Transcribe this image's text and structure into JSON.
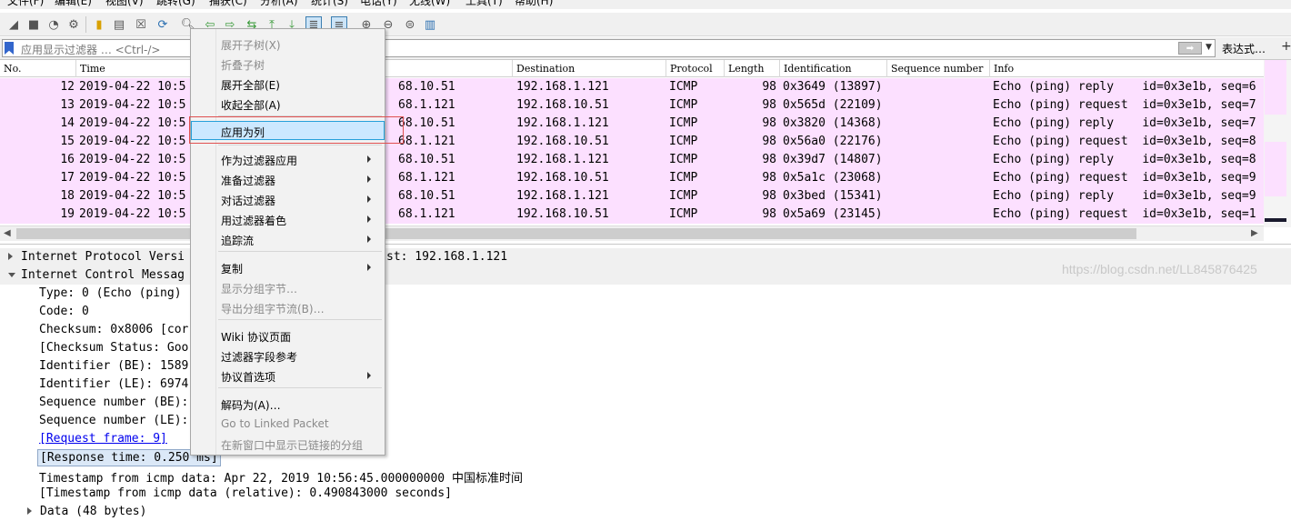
{
  "menubar": [
    "文件(F)",
    "编辑(E)",
    "视图(V)",
    "跳转(G)",
    "捕获(C)",
    "分析(A)",
    "统计(S)",
    "电话(Y)",
    "无线(W)",
    "工具(T)",
    "帮助(H)"
  ],
  "filter": {
    "placeholder": "应用显示过滤器 … <Ctrl-/>",
    "expression_label": "表达式…",
    "plus": "+"
  },
  "columns": [
    "No.",
    "Time",
    "Source",
    "Destination",
    "Protocol",
    "Length",
    "Identification",
    "Sequence number",
    "Info"
  ],
  "packets": [
    {
      "no": "12",
      "time": "2019-04-22 10:5",
      "src": "68.10.51",
      "dst": "192.168.1.121",
      "proto": "ICMP",
      "len": "98",
      "id": "0x3649 (13897)",
      "info": "Echo (ping) reply    id=0x3e1b, seq=6"
    },
    {
      "no": "13",
      "time": "2019-04-22 10:5",
      "src": "68.1.121",
      "dst": "192.168.10.51",
      "proto": "ICMP",
      "len": "98",
      "id": "0x565d (22109)",
      "info": "Echo (ping) request  id=0x3e1b, seq=7"
    },
    {
      "no": "14",
      "time": "2019-04-22 10:5",
      "src": "68.10.51",
      "dst": "192.168.1.121",
      "proto": "ICMP",
      "len": "98",
      "id": "0x3820 (14368)",
      "info": "Echo (ping) reply    id=0x3e1b, seq=7"
    },
    {
      "no": "15",
      "time": "2019-04-22 10:5",
      "src": "68.1.121",
      "dst": "192.168.10.51",
      "proto": "ICMP",
      "len": "98",
      "id": "0x56a0 (22176)",
      "info": "Echo (ping) request  id=0x3e1b, seq=8"
    },
    {
      "no": "16",
      "time": "2019-04-22 10:5",
      "src": "68.10.51",
      "dst": "192.168.1.121",
      "proto": "ICMP",
      "len": "98",
      "id": "0x39d7 (14807)",
      "info": "Echo (ping) reply    id=0x3e1b, seq=8"
    },
    {
      "no": "17",
      "time": "2019-04-22 10:5",
      "src": "68.1.121",
      "dst": "192.168.10.51",
      "proto": "ICMP",
      "len": "98",
      "id": "0x5a1c (23068)",
      "info": "Echo (ping) request  id=0x3e1b, seq=9"
    },
    {
      "no": "18",
      "time": "2019-04-22 10:5",
      "src": "68.10.51",
      "dst": "192.168.1.121",
      "proto": "ICMP",
      "len": "98",
      "id": "0x3bed (15341)",
      "info": "Echo (ping) reply    id=0x3e1b, seq=9"
    },
    {
      "no": "19",
      "time": "2019-04-22 10:5",
      "src": "68.1.121",
      "dst": "192.168.10.51",
      "proto": "ICMP",
      "len": "98",
      "id": "0x5a69 (23145)",
      "info": "Echo (ping) request  id=0x3e1b, seq=1"
    }
  ],
  "details": [
    {
      "text": "Internet Protocol Versi",
      "extra": "st: 192.168.1.121",
      "expander": "collapsed"
    },
    {
      "text": "Internet Control Messag",
      "extra": "",
      "expander": "expanded"
    },
    {
      "text": "Type: 0 (Echo (ping)",
      "extra": "",
      "expander": "none"
    },
    {
      "text": "Code: 0",
      "extra": "",
      "expander": "none"
    },
    {
      "text": "Checksum: 0x8006 [cor",
      "extra": "",
      "expander": "none"
    },
    {
      "text": "[Checksum Status: Goo",
      "extra": "",
      "expander": "none"
    },
    {
      "text": "Identifier (BE): 1589",
      "extra": "",
      "expander": "none"
    },
    {
      "text": "Identifier (LE): 6974",
      "extra": "",
      "expander": "none"
    },
    {
      "text": "Sequence number (BE):",
      "extra": "",
      "expander": "none"
    },
    {
      "text": "Sequence number (LE):",
      "extra": "",
      "expander": "none"
    },
    {
      "text": "[Request frame: 9]",
      "extra": "",
      "expander": "none",
      "link": true
    },
    {
      "text": "[Response time: 0.250 ms]",
      "extra": "",
      "expander": "none",
      "selected": true
    },
    {
      "text": "Timestamp from icmp data: Apr 22, 2019 10:56:45.000000000 中国标准时间",
      "extra": "",
      "expander": "none"
    },
    {
      "text": "[Timestamp from icmp data (relative): 0.490843000 seconds]",
      "extra": "",
      "expander": "none"
    },
    {
      "text": "Data (48 bytes)",
      "extra": "",
      "expander": "collapsed"
    }
  ],
  "context_menu": {
    "expand_subtrees": "展开子树(X)",
    "collapse_subtrees": "折叠子树",
    "expand_all": "展开全部(E)",
    "collapse_all": "收起全部(A)",
    "apply_as_column": "应用为列",
    "apply_as_filter": "作为过滤器应用",
    "prepare_filter": "准备过滤器",
    "conversation_filter": "对话过滤器",
    "colorize_filter": "用过滤器着色",
    "follow_stream": "追踪流",
    "copy": "复制",
    "show_packet_bytes": "显示分组字节…",
    "export_packet_bytes": "导出分组字节流(B)…",
    "wiki_page": "Wiki 协议页面",
    "filter_field_ref": "过滤器字段参考",
    "protocol_prefs": "协议首选项",
    "decode_as": "解码为(A)…",
    "go_to_linked": "Go to Linked Packet",
    "show_linked_new_window": "在新窗口中显示已链接的分组"
  },
  "watermark": "https://blog.csdn.net/LL845876425",
  "colors": {
    "row_bg": "#fce0ff",
    "menu_highlight": "#cce8ff",
    "highlight_border": "#e05050"
  }
}
